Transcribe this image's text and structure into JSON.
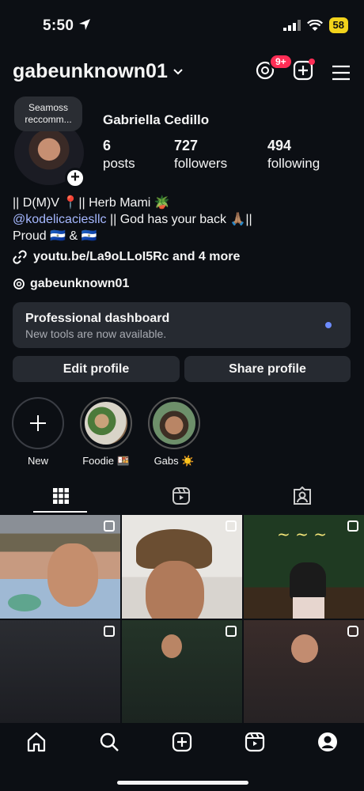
{
  "status": {
    "time": "5:50",
    "battery": "58"
  },
  "header": {
    "username": "gabeunknown01",
    "threads_badge": "9+"
  },
  "note": {
    "text": "Seamoss reccomm..."
  },
  "profile": {
    "full_name": "Gabriella Cedillo",
    "posts_count": "6",
    "posts_label": "posts",
    "followers_count": "727",
    "followers_label": "followers",
    "following_count": "494",
    "following_label": "following"
  },
  "bio": {
    "line1": "|| D(M)V 📍|| Herb Mami 🪴",
    "mention": "@kodelicaciesllc",
    "line2_rest": " || God has your back 🙏🏽||",
    "line3": "Proud 🇸🇻 & 🇸🇻"
  },
  "link": {
    "text": "youtu.be/La9oLLoI5Rc and 4 more"
  },
  "threads": {
    "handle": "gabeunknown01"
  },
  "dashboard": {
    "title": "Professional dashboard",
    "subtitle": "New tools are now available."
  },
  "buttons": {
    "edit": "Edit profile",
    "share": "Share profile"
  },
  "highlights": [
    {
      "label": "New"
    },
    {
      "label": "Foodie 🍱"
    },
    {
      "label": "Gabs ☀️"
    }
  ],
  "colors": {
    "background": "#0c0f14",
    "card": "#262a31",
    "accent_blue": "#6d8cff",
    "badge_red": "#ff2d55",
    "mention": "#a6b8ff"
  },
  "icons": [
    "location-arrow-icon",
    "signal-icon",
    "wifi-icon",
    "chevron-down-icon",
    "threads-icon",
    "new-post-icon",
    "menu-icon",
    "link-icon",
    "grid-icon",
    "reels-icon",
    "tagged-icon",
    "home-icon",
    "search-icon",
    "create-icon",
    "reels-nav-icon",
    "profile-icon"
  ]
}
